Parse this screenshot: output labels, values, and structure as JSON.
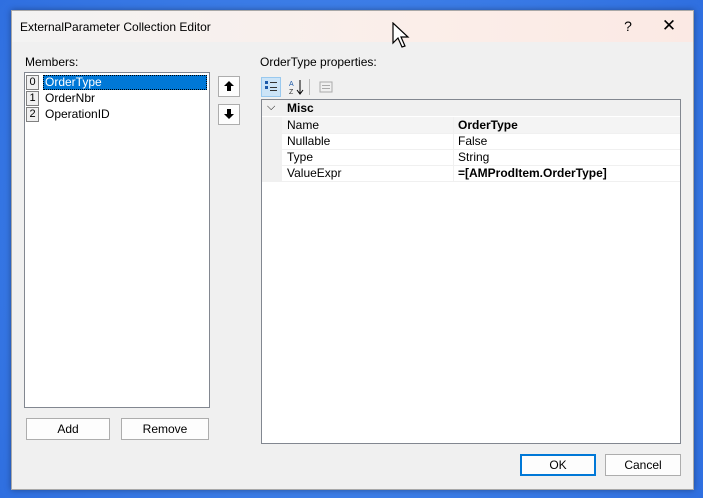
{
  "dialog": {
    "title": "ExternalParameter Collection Editor",
    "help_label": "?",
    "close_label": "✕"
  },
  "members": {
    "label": "Members:",
    "items": [
      {
        "index": "0",
        "name": "OrderType"
      },
      {
        "index": "1",
        "name": "OrderNbr"
      },
      {
        "index": "2",
        "name": "OperationID"
      }
    ],
    "move_up_label": "🡅",
    "move_down_label": "🡇",
    "add_label": "Add",
    "remove_label": "Remove"
  },
  "properties": {
    "label": "OrderType properties:",
    "toolbar_icons": [
      "categorized-icon",
      "alphabetical-icon",
      "property-pages-icon"
    ],
    "category": "Misc",
    "rows": [
      {
        "name": "Name",
        "value": "OrderType",
        "bold": true
      },
      {
        "name": "Nullable",
        "value": "False",
        "bold": false
      },
      {
        "name": "Type",
        "value": "String",
        "bold": false
      },
      {
        "name": "ValueExpr",
        "value": "=[AMProdItem.OrderType]",
        "bold": true
      }
    ]
  },
  "footer": {
    "ok_label": "OK",
    "cancel_label": "Cancel"
  },
  "colors": {
    "selection": "#0078d7",
    "background": "#3b7be8"
  }
}
